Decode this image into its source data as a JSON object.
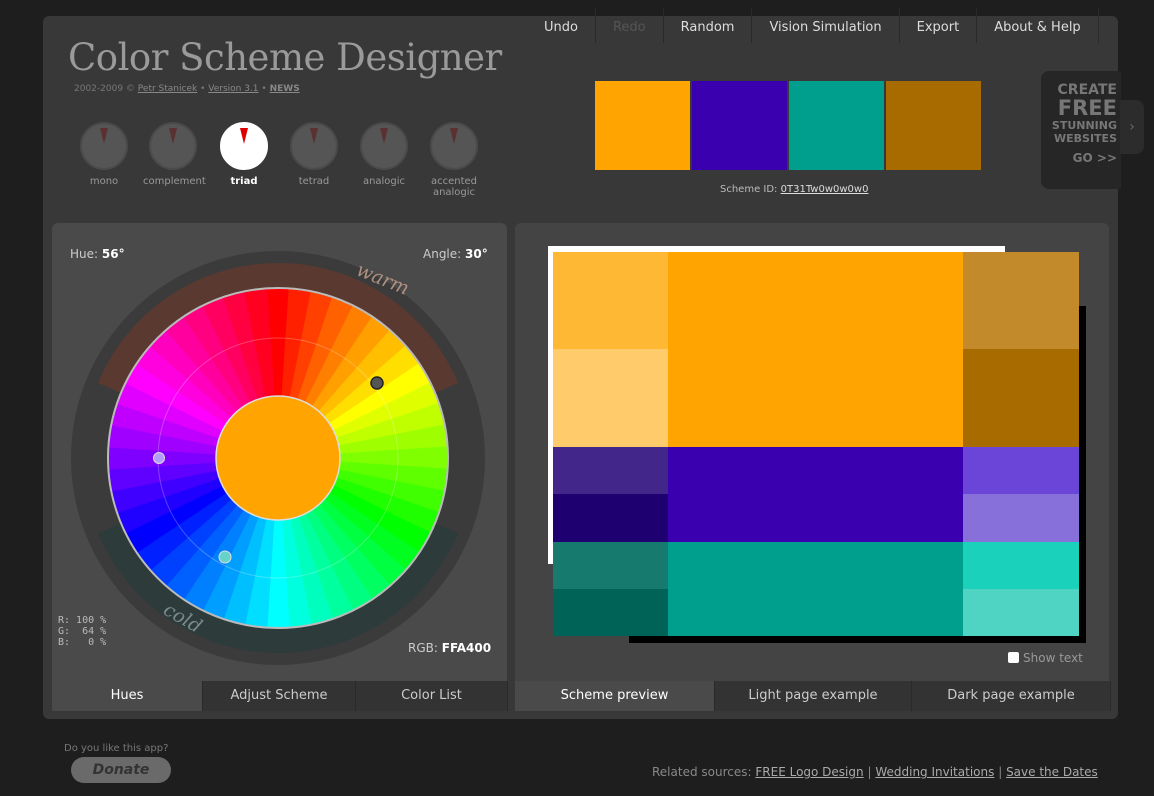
{
  "app": {
    "title": "Color Scheme Designer",
    "credit_prefix": "2002-2009 ©",
    "credit_author": "Petr Stanicek",
    "credit_version": "Version 3.1",
    "credit_news": "NEWS",
    "credit_sep": "•"
  },
  "modes": [
    {
      "label": "mono"
    },
    {
      "label": "complement"
    },
    {
      "label": "triad",
      "active": true
    },
    {
      "label": "tetrad"
    },
    {
      "label": "analogic"
    },
    {
      "label": "accented analogic"
    }
  ],
  "nav": [
    "Undo",
    "Redo",
    "Random",
    "Vision Simulation",
    "Export",
    "About & Help"
  ],
  "scheme": {
    "colors": [
      "#FFA400",
      "#3A00B0",
      "#009E8C",
      "#A86B00"
    ],
    "id_label": "Scheme ID:",
    "id_value": "0T31Tw0w0w0w0"
  },
  "ad": {
    "l1": "CREATE",
    "l2": "FREE",
    "l3": "STUNNING",
    "l4": "WEBSITES",
    "l5": "GO >>"
  },
  "wheel": {
    "hue_label": "Hue:",
    "hue_value": "56°",
    "angle_label": "Angle:",
    "angle_value": "30°",
    "warm_label": "warm",
    "cold_label": "cold",
    "rgb_text": "R: 100 %\nG:  64 %\nB:   0 %",
    "rgb_label": "RGB:",
    "rgb_value": "FFA400",
    "center_color": "#FFA400"
  },
  "left_tabs": [
    "Hues",
    "Adjust Scheme",
    "Color List"
  ],
  "right_tabs": [
    "Scheme preview",
    "Light page example",
    "Dark page example"
  ],
  "show_text": "Show text",
  "donate": {
    "question": "Do you like this app?",
    "button": "Donate"
  },
  "related": {
    "label": "Related sources:",
    "links": [
      "FREE Logo Design",
      "Wedding Invitations",
      "Save the Dates"
    ],
    "sep": "|"
  },
  "preview_colors": {
    "primary": [
      "#FFB833",
      "#FFCB6B",
      "#FFA400",
      "#C28A2A",
      "#A86B00"
    ],
    "secondary": [
      "#43268A",
      "#1F0070",
      "#3A00B0",
      "#6B45D8",
      "#8870DA"
    ],
    "tertiary": [
      "#177A6E",
      "#006358",
      "#009E8C",
      "#1AD1BC",
      "#4FD4C3"
    ]
  }
}
